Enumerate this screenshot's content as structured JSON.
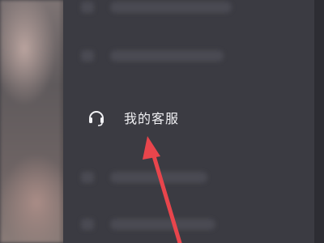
{
  "menu": {
    "customer_service": {
      "label": "我的客服",
      "icon": "headset-icon"
    }
  },
  "annotation": {
    "arrow_color": "#e8454c"
  },
  "colors": {
    "drawer_bg": "#3b3b42",
    "text": "#f1f1f4"
  }
}
